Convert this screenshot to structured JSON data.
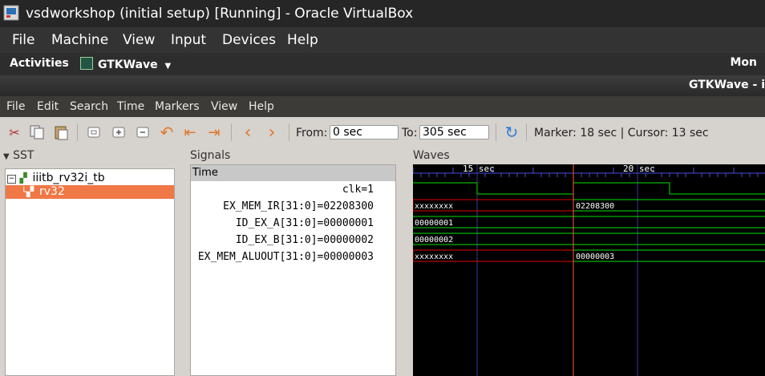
{
  "vbox": {
    "title": "vsdworkshop (initial setup) [Running] - Oracle VirtualBox",
    "menu": [
      "File",
      "Machine",
      "View",
      "Input",
      "Devices",
      "Help"
    ]
  },
  "ubuntu": {
    "activities": "Activities",
    "app_name": "GTKWave",
    "clock": "Mon"
  },
  "gtkwave": {
    "window_title": "GTKWave - i",
    "menu": [
      "File",
      "Edit",
      "Search",
      "Time",
      "Markers",
      "View",
      "Help"
    ],
    "toolbar": {
      "from_label": "From:",
      "from_value": "0 sec",
      "to_label": "To:",
      "to_value": "305 sec",
      "marker_text": "Marker: 18 sec  |  Cursor: 13 sec"
    },
    "sst": {
      "label": "SST",
      "root": "iiitb_rv32i_tb",
      "child": "rv32"
    },
    "signals": {
      "label": "Signals",
      "header": "Time",
      "rows": [
        "clk=1",
        "EX_MEM_IR[31:0]=02208300",
        "ID_EX_A[31:0]=00000001",
        "ID_EX_B[31:0]=00000002",
        "EX_MEM_ALUOUT[31:0]=00000003"
      ]
    },
    "waves": {
      "label": "Waves",
      "tick_15": "15 sec",
      "tick_20": "20 sec",
      "ir_before": "xxxxxxxx",
      "ir_after": "02208300",
      "a_value": "00000001",
      "b_value": "00000002",
      "aluout_before": "xxxxxxxx",
      "aluout_after": "00000003"
    }
  },
  "colors": {
    "wave_green": "#00e000",
    "wave_red": "#e00000",
    "marker_line": "#ff5a36",
    "grid_line": "#3a3a9a",
    "selection": "#f07746"
  }
}
